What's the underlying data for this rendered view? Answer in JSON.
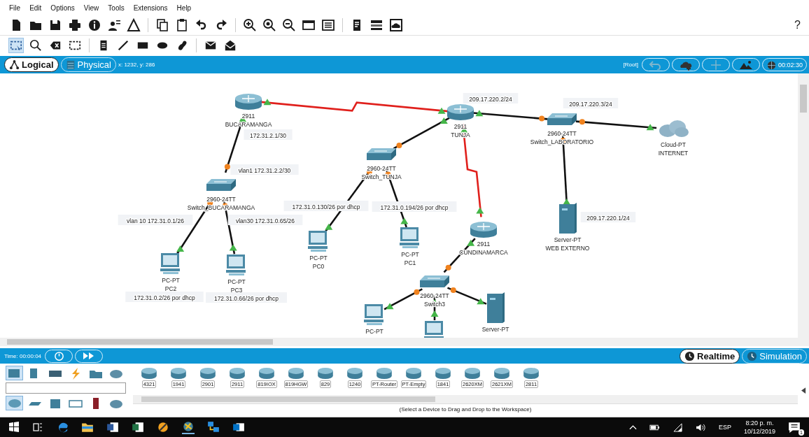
{
  "menu": [
    "File",
    "Edit",
    "Options",
    "View",
    "Tools",
    "Extensions",
    "Help"
  ],
  "help_button": "?",
  "workspace_tabs": [
    {
      "label": "Logical",
      "selected": true
    },
    {
      "label": "Physical",
      "selected": false
    }
  ],
  "cursor_position": "x: 1232, y: 286",
  "root_label": "[Root]",
  "clock": "00:02:30",
  "nodes": [
    {
      "kind": "router",
      "model": "2911",
      "name": "BUCARAMANGA"
    },
    {
      "kind": "router",
      "model": "2911",
      "name": "TUNJA"
    },
    {
      "kind": "switch",
      "model": "2960-24TT",
      "name": "Switch_LABORATORIO"
    },
    {
      "kind": "cloud",
      "model": "Cloud-PT",
      "name": "INTERNET"
    },
    {
      "kind": "switch",
      "model": "2960-24TT",
      "name": "Switch_BUCARAMANGA"
    },
    {
      "kind": "switch",
      "model": "2960-24TT",
      "name": "Switch_TUNJA"
    },
    {
      "kind": "server",
      "model": "Server-PT",
      "name": "WEB EXTERNO"
    },
    {
      "kind": "pc",
      "model": "PC-PT",
      "name": "PC2"
    },
    {
      "kind": "pc",
      "model": "PC-PT",
      "name": "PC3"
    },
    {
      "kind": "pc",
      "model": "PC-PT",
      "name": "PC0"
    },
    {
      "kind": "pc",
      "model": "PC-PT",
      "name": "PC1"
    },
    {
      "kind": "router",
      "model": "2911",
      "name": "CUNDINAMARCA"
    },
    {
      "kind": "switch",
      "model": "2960-24TT",
      "name": "Switch3"
    },
    {
      "kind": "pc",
      "model": "PC-PT"
    },
    {
      "kind": "pc"
    },
    {
      "kind": "server",
      "model": "Server-PT"
    }
  ],
  "links": [
    {
      "kind": "serial",
      "end_a_forwarding": true,
      "end_b_forwarding": true
    },
    {
      "kind": "ethernet",
      "end_a_forwarding": true,
      "end_b_forwarding": false
    },
    {
      "kind": "ethernet",
      "end_a_forwarding": false,
      "end_b_forwarding": true
    },
    {
      "kind": "ethernet",
      "end_a_forwarding": false,
      "end_b_forwarding": true
    },
    {
      "kind": "ethernet",
      "end_a_forwarding": true,
      "end_b_forwarding": false
    },
    {
      "kind": "ethernet",
      "end_a_forwarding": false,
      "end_b_forwarding": true
    },
    {
      "kind": "ethernet",
      "end_a_forwarding": false,
      "end_b_forwarding": true
    },
    {
      "kind": "ethernet",
      "end_a_forwarding": true,
      "end_b_forwarding": false
    },
    {
      "kind": "ethernet",
      "end_a_forwarding": false,
      "end_b_forwarding": true
    },
    {
      "kind": "ethernet",
      "end_a_forwarding": false,
      "end_b_forwarding": true
    },
    {
      "kind": "serial",
      "end_a_forwarding": true,
      "end_b_forwarding": true
    },
    {
      "kind": "ethernet",
      "end_a_forwarding": true,
      "end_b_forwarding": false
    },
    {
      "kind": "ethernet",
      "end_a_forwarding": false,
      "end_b_forwarding": true
    },
    {
      "kind": "ethernet",
      "end_a_forwarding": true,
      "end_b_forwarding": true
    },
    {
      "kind": "ethernet",
      "end_a_forwarding": false,
      "end_b_forwarding": true
    }
  ],
  "notes": [
    "209.17.220.2/24",
    "209.17.220.3/24",
    "172.31.2.1/30",
    "vlan1 172.31.2.2/30",
    "172.31.0.130/26 por dhcp",
    "172.31.0.194/26 por dhcp",
    "209.17.220.1/24",
    "vlan 10 172.31.0.1/26",
    "vlan30 172.31.0.65/26",
    "172.31.0.2/26 por dhcp",
    "172.31.0.66/26 por dhcp"
  ],
  "sim_time": "Time: 00:00:04",
  "modes": [
    {
      "label": "Realtime",
      "selected": true
    },
    {
      "label": "Simulation",
      "selected": false
    }
  ],
  "categories": [
    {
      "selected": true
    },
    {
      "selected": false
    },
    {
      "selected": false
    },
    {
      "selected": false
    },
    {
      "selected": false
    },
    {
      "selected": false
    }
  ],
  "subcategories": [
    {
      "selected": true
    },
    {
      "selected": false
    },
    {
      "selected": false
    },
    {
      "selected": false
    },
    {
      "selected": false
    },
    {
      "selected": false
    }
  ],
  "device_models": [
    "4321",
    "1941",
    "2901",
    "2911",
    "819IOX",
    "819HGW",
    "829",
    "1240",
    "PT-Router",
    "PT-Empty",
    "1841",
    "2620XM",
    "2621XM",
    "2811"
  ],
  "device_hint": "(Select a Device to Drag and Drop to the Workspace)",
  "taskbar": {
    "language": "ESP",
    "time": "8:20 p. m.",
    "date": "10/12/2019",
    "notification_count": "1"
  }
}
